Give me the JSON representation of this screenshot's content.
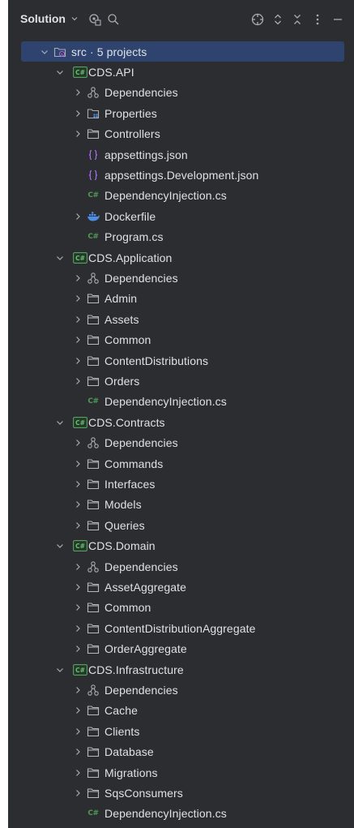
{
  "toolbar": {
    "title": "Solution"
  },
  "tree": [
    {
      "label": "src · 5 projects",
      "type": "solution-folder",
      "level": 0,
      "expanded": true,
      "selected": true
    },
    {
      "label": "CDS.API",
      "type": "project",
      "level": 1,
      "expanded": true
    },
    {
      "label": "Dependencies",
      "type": "dependencies",
      "level": 2,
      "expanded": false
    },
    {
      "label": "Properties",
      "type": "properties",
      "level": 2,
      "expanded": false
    },
    {
      "label": "Controllers",
      "type": "folder",
      "level": 2,
      "expanded": false
    },
    {
      "label": "appsettings.json",
      "type": "json",
      "level": 2
    },
    {
      "label": "appsettings.Development.json",
      "type": "json",
      "level": 2
    },
    {
      "label": "DependencyInjection.cs",
      "type": "cs",
      "level": 2
    },
    {
      "label": "Dockerfile",
      "type": "docker",
      "level": 2,
      "expanded": false
    },
    {
      "label": "Program.cs",
      "type": "cs",
      "level": 2
    },
    {
      "label": "CDS.Application",
      "type": "project",
      "level": 1,
      "expanded": true
    },
    {
      "label": "Dependencies",
      "type": "dependencies",
      "level": 2,
      "expanded": false
    },
    {
      "label": "Admin",
      "type": "folder",
      "level": 2,
      "expanded": false
    },
    {
      "label": "Assets",
      "type": "folder",
      "level": 2,
      "expanded": false
    },
    {
      "label": "Common",
      "type": "folder",
      "level": 2,
      "expanded": false
    },
    {
      "label": "ContentDistributions",
      "type": "folder",
      "level": 2,
      "expanded": false
    },
    {
      "label": "Orders",
      "type": "folder",
      "level": 2,
      "expanded": false
    },
    {
      "label": "DependencyInjection.cs",
      "type": "cs",
      "level": 2
    },
    {
      "label": "CDS.Contracts",
      "type": "project",
      "level": 1,
      "expanded": true
    },
    {
      "label": "Dependencies",
      "type": "dependencies",
      "level": 2,
      "expanded": false
    },
    {
      "label": "Commands",
      "type": "folder",
      "level": 2,
      "expanded": false
    },
    {
      "label": "Interfaces",
      "type": "folder",
      "level": 2,
      "expanded": false
    },
    {
      "label": "Models",
      "type": "folder",
      "level": 2,
      "expanded": false
    },
    {
      "label": "Queries",
      "type": "folder",
      "level": 2,
      "expanded": false
    },
    {
      "label": "CDS.Domain",
      "type": "project",
      "level": 1,
      "expanded": true
    },
    {
      "label": "Dependencies",
      "type": "dependencies",
      "level": 2,
      "expanded": false
    },
    {
      "label": "AssetAggregate",
      "type": "folder",
      "level": 2,
      "expanded": false
    },
    {
      "label": "Common",
      "type": "folder",
      "level": 2,
      "expanded": false
    },
    {
      "label": "ContentDistributionAggregate",
      "type": "folder",
      "level": 2,
      "expanded": false
    },
    {
      "label": "OrderAggregate",
      "type": "folder",
      "level": 2,
      "expanded": false
    },
    {
      "label": "CDS.Infrastructure",
      "type": "project",
      "level": 1,
      "expanded": true
    },
    {
      "label": "Dependencies",
      "type": "dependencies",
      "level": 2,
      "expanded": false
    },
    {
      "label": "Cache",
      "type": "folder",
      "level": 2,
      "expanded": false
    },
    {
      "label": "Clients",
      "type": "folder",
      "level": 2,
      "expanded": false
    },
    {
      "label": "Database",
      "type": "folder",
      "level": 2,
      "expanded": false
    },
    {
      "label": "Migrations",
      "type": "folder",
      "level": 2,
      "expanded": false
    },
    {
      "label": "SqsConsumers",
      "type": "folder",
      "level": 2,
      "expanded": false
    },
    {
      "label": "DependencyInjection.cs",
      "type": "cs",
      "level": 2
    }
  ]
}
